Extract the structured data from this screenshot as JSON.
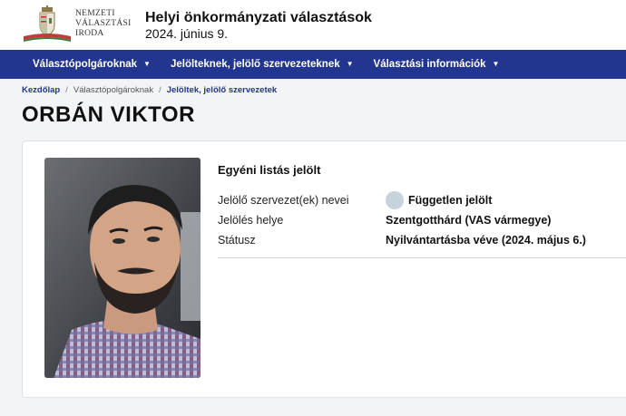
{
  "header": {
    "logo_lines": [
      "NEMZETI",
      "VÁLASZTÁSI",
      "IRODA"
    ],
    "title": "Helyi önkormányzati választások",
    "date": "2024. június 9."
  },
  "nav": {
    "items": [
      {
        "label": "Választópolgároknak"
      },
      {
        "label": "Jelölteknek, jelölő szervezeteknek"
      },
      {
        "label": "Választási információk"
      }
    ]
  },
  "breadcrumb": {
    "home": "Kezdőlap",
    "middle": "Választópolgároknak",
    "current": "Jelöltek, jelölő szervezetek"
  },
  "page": {
    "title": "ORBÁN VIKTOR"
  },
  "candidate": {
    "heading": "Egyéni listás jelölt",
    "rows": [
      {
        "label": "Jelölő szervezet(ek) nevei",
        "value": "Független jelölt"
      },
      {
        "label": "Jelölés helye",
        "value": "Szentgotthárd (VAS vármegye)"
      },
      {
        "label": "Státusz",
        "value": "Nyilvántartásba véve (2024. május 6.)"
      }
    ]
  },
  "colors": {
    "nav_bg": "#22358f",
    "accent": "#22358f",
    "party_dot": "#c6d3db"
  },
  "icons": {
    "logo": "coat-of-arms-icon",
    "caret": "chevron-down-icon",
    "party": "party-logo-icon"
  }
}
